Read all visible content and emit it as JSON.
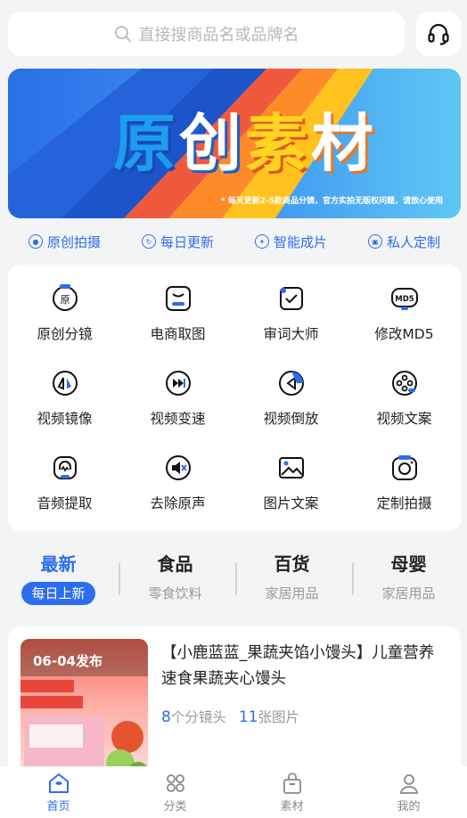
{
  "search": {
    "placeholder": "直接搜商品名或品牌名"
  },
  "banner": {
    "title_chars": [
      "原",
      "创",
      "素",
      "材"
    ],
    "note": "* 每天更新2-5款商品分镜，官方实拍无版权问题，请放心使用"
  },
  "tags": [
    {
      "label": "原创拍摄",
      "icon": "camera-icon"
    },
    {
      "label": "每日更新",
      "icon": "refresh-icon"
    },
    {
      "label": "智能成片",
      "icon": "magic-icon"
    },
    {
      "label": "私人定制",
      "icon": "custom-icon"
    }
  ],
  "tools": [
    {
      "label": "原创分镜",
      "icon": "original-storyboard-icon"
    },
    {
      "label": "电商取图",
      "icon": "ecommerce-image-icon"
    },
    {
      "label": "审词大师",
      "icon": "word-review-icon"
    },
    {
      "label": "修改MD5",
      "icon": "md5-icon"
    },
    {
      "label": "视频镜像",
      "icon": "video-mirror-icon"
    },
    {
      "label": "视频变速",
      "icon": "video-speed-icon"
    },
    {
      "label": "视频倒放",
      "icon": "video-reverse-icon"
    },
    {
      "label": "视频文案",
      "icon": "video-copy-icon"
    },
    {
      "label": "音频提取",
      "icon": "audio-extract-icon"
    },
    {
      "label": "去除原声",
      "icon": "remove-audio-icon"
    },
    {
      "label": "图片文案",
      "icon": "image-text-icon"
    },
    {
      "label": "定制拍摄",
      "icon": "custom-shoot-icon"
    }
  ],
  "categories": [
    {
      "title": "最新",
      "sub": "每日上新"
    },
    {
      "title": "食品",
      "sub": "零食饮料"
    },
    {
      "title": "百货",
      "sub": "家居用品"
    },
    {
      "title": "母婴",
      "sub": "家居用品"
    }
  ],
  "product": {
    "date_badge": "06-04发布",
    "title": "【小鹿蓝蓝_果蔬夹馅小馒头】儿童营养速食果蔬夹心馒头",
    "shots_count": "8",
    "shots_label": "个分镜头",
    "images_count": "11",
    "images_label": "张图片"
  },
  "nav": [
    {
      "label": "首页",
      "icon": "home-icon"
    },
    {
      "label": "分类",
      "icon": "grid-icon"
    },
    {
      "label": "素材",
      "icon": "bag-icon"
    },
    {
      "label": "我的",
      "icon": "user-icon"
    }
  ],
  "colors": {
    "accent": "#2d6df0",
    "background": "#f3f4f6"
  }
}
